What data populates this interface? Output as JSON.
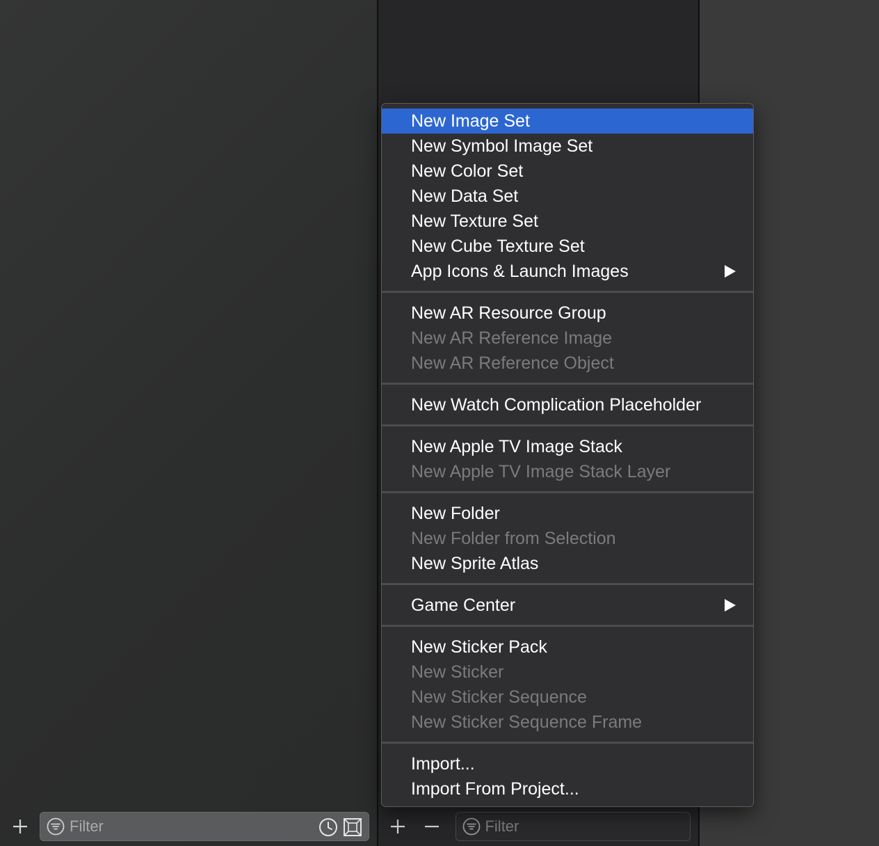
{
  "left_panel": {
    "filter_placeholder": "Filter",
    "icons": [
      "plus-icon",
      "filter-lines-icon",
      "clock-icon",
      "missing-image-icon"
    ]
  },
  "middle_panel": {
    "filter_placeholder": "Filter",
    "icons": [
      "plus-icon",
      "minus-icon",
      "filter-lines-icon"
    ]
  },
  "menu": {
    "groups": [
      [
        {
          "label": "New Image Set",
          "enabled": true,
          "selected": true
        },
        {
          "label": "New Symbol Image Set",
          "enabled": true
        },
        {
          "label": "New Color Set",
          "enabled": true
        },
        {
          "label": "New Data Set",
          "enabled": true
        },
        {
          "label": "New Texture Set",
          "enabled": true
        },
        {
          "label": "New Cube Texture Set",
          "enabled": true
        },
        {
          "label": "App Icons & Launch Images",
          "enabled": true,
          "submenu": true
        }
      ],
      [
        {
          "label": "New AR Resource Group",
          "enabled": true
        },
        {
          "label": "New AR Reference Image",
          "enabled": false
        },
        {
          "label": "New AR Reference Object",
          "enabled": false
        }
      ],
      [
        {
          "label": "New Watch Complication Placeholder",
          "enabled": true
        }
      ],
      [
        {
          "label": "New Apple TV Image Stack",
          "enabled": true
        },
        {
          "label": "New Apple TV Image Stack Layer",
          "enabled": false
        }
      ],
      [
        {
          "label": "New Folder",
          "enabled": true
        },
        {
          "label": "New Folder from Selection",
          "enabled": false
        },
        {
          "label": "New Sprite Atlas",
          "enabled": true
        }
      ],
      [
        {
          "label": "Game Center",
          "enabled": true,
          "submenu": true
        }
      ],
      [
        {
          "label": "New Sticker Pack",
          "enabled": true
        },
        {
          "label": "New Sticker",
          "enabled": false
        },
        {
          "label": "New Sticker Sequence",
          "enabled": false
        },
        {
          "label": "New Sticker Sequence Frame",
          "enabled": false
        }
      ],
      [
        {
          "label": "Import...",
          "enabled": true
        },
        {
          "label": "Import From Project...",
          "enabled": true
        }
      ]
    ]
  },
  "colors": {
    "selection": "#2c67d1",
    "menu_background": "#2f2f31",
    "enabled_text": "#ffffff",
    "disabled_text": "#7b7b7d"
  }
}
